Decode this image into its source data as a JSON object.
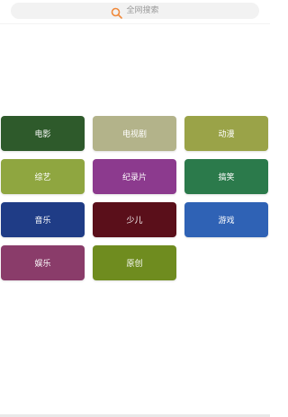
{
  "search": {
    "placeholder_text": "全网搜索",
    "icon": "search-icon",
    "icon_color": "#f08a3c"
  },
  "categories": [
    {
      "label": "电影",
      "color": "#2e5a2b"
    },
    {
      "label": "电视剧",
      "color": "#b3b38a"
    },
    {
      "label": "动漫",
      "color": "#9aa348"
    },
    {
      "label": "综艺",
      "color": "#8fa640"
    },
    {
      "label": "纪录片",
      "color": "#8c3a8e"
    },
    {
      "label": "搞笑",
      "color": "#2b7a4b"
    },
    {
      "label": "音乐",
      "color": "#1f3c86"
    },
    {
      "label": "少儿",
      "color": "#5a0f1a"
    },
    {
      "label": "游戏",
      "color": "#2f62b5"
    },
    {
      "label": "娱乐",
      "color": "#8a3c6a"
    },
    {
      "label": "原创",
      "color": "#6f8c1f"
    }
  ]
}
